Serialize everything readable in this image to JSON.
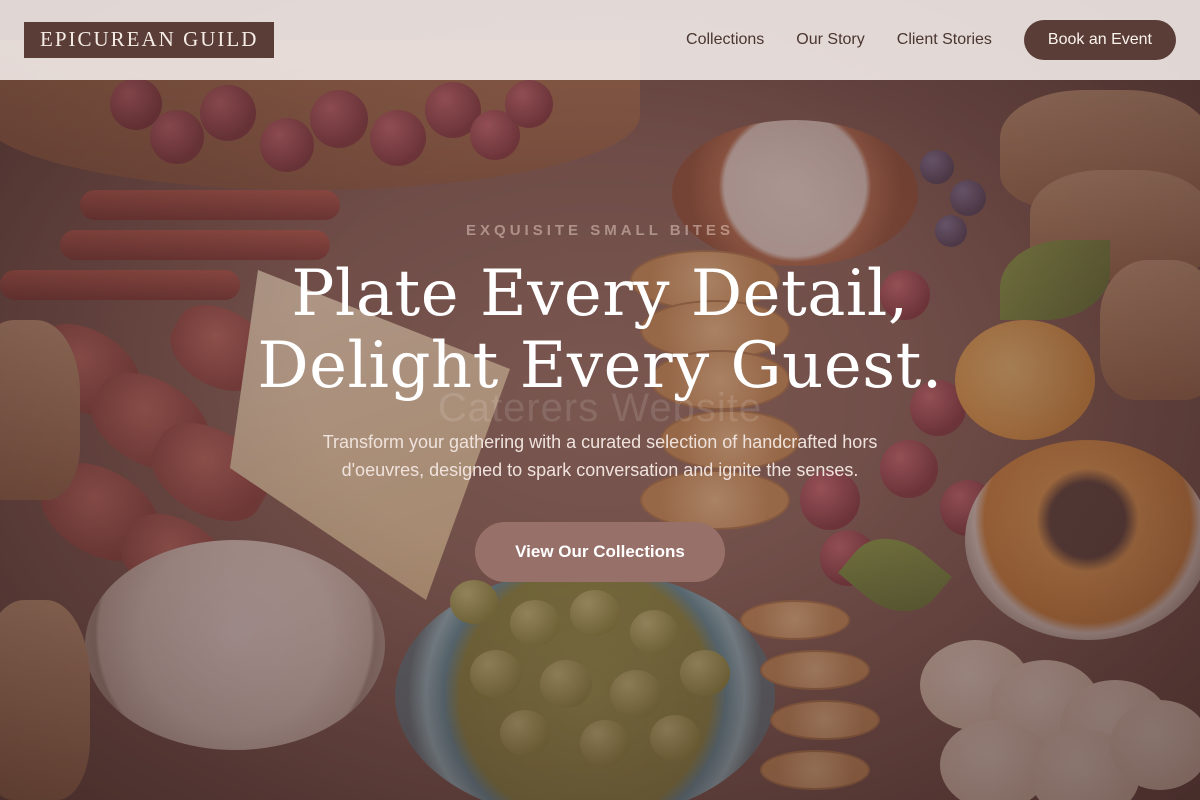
{
  "header": {
    "logo_text": "EPICUREAN GUILD",
    "nav": [
      {
        "label": "Collections"
      },
      {
        "label": "Our Story"
      },
      {
        "label": "Client Stories"
      }
    ],
    "cta_label": "Book an Event"
  },
  "hero": {
    "eyebrow": "EXQUISITE SMALL BITES",
    "headline_line1": "Plate Every Detail,",
    "headline_line2": "Delight Every Guest.",
    "ghost_text": "Caterers Website",
    "subtext": "Transform your gathering with a curated selection of handcrafted hors d'oeuvres, designed to spark conversation and ignite the senses.",
    "button_label": "View Our Collections"
  },
  "colors": {
    "brand_dark": "#5a3d36",
    "button_muted": "#977069",
    "header_bg": "#f5eeec"
  }
}
